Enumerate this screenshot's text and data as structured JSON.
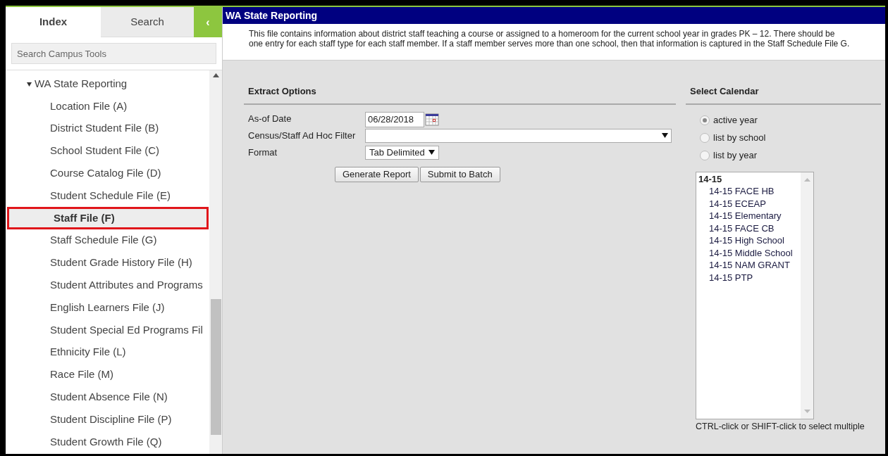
{
  "sidebar": {
    "tabs": [
      {
        "label": "Index",
        "selected": true
      },
      {
        "label": "Search",
        "selected": false
      }
    ],
    "collapse_button": "‹",
    "search": {
      "placeholder": "Search Campus Tools"
    },
    "tree": [
      {
        "label": "WA State Reporting",
        "expanded": true,
        "children": [
          {
            "label": "Location File (A)",
            "selected": false
          },
          {
            "label": "District Student File (B)",
            "selected": false
          },
          {
            "label": "School Student File (C)",
            "selected": false
          },
          {
            "label": "Course Catalog File (D)",
            "selected": false
          },
          {
            "label": "Student Schedule File (E)",
            "selected": false
          },
          {
            "label": "Staff File (F)",
            "selected": true
          },
          {
            "label": "Staff Schedule File (G)",
            "selected": false
          },
          {
            "label": "Student Grade History File (H)",
            "selected": false
          },
          {
            "label": "Student Attributes and Programs",
            "selected": false
          },
          {
            "label": "English Learners File (J)",
            "selected": false
          },
          {
            "label": "Student Special Ed Programs Fil",
            "selected": false
          },
          {
            "label": "Ethnicity File (L)",
            "selected": false
          },
          {
            "label": "Race File (M)",
            "selected": false
          },
          {
            "label": "Student Absence File (N)",
            "selected": false
          },
          {
            "label": "Student Discipline File (P)",
            "selected": false
          },
          {
            "label": "Student Growth File (Q)",
            "selected": false
          }
        ]
      }
    ]
  },
  "main": {
    "title": "WA State Reporting",
    "description": "This file contains information about district staff teaching a course or assigned to a homeroom for the current school year in grades PK – 12. There should be one entry for each staff type for each staff member. If a staff member serves more than one school, then that information is captured in the Staff Schedule File G.",
    "extract_options": {
      "heading": "Extract Options",
      "fields": [
        {
          "kind": "date",
          "label": "As-of Date",
          "value": "06/28/2018"
        },
        {
          "kind": "select_wide",
          "label": "Census/Staff Ad Hoc Filter"
        },
        {
          "kind": "select",
          "label": "Format",
          "value": "Tab Delimited"
        }
      ],
      "buttons": [
        "Generate Report",
        "Submit to Batch"
      ]
    },
    "select_calendar": {
      "heading": "Select Calendar",
      "options": [
        {
          "label": "active year",
          "selected": true
        },
        {
          "label": "list by school",
          "selected": false
        },
        {
          "label": "list by year",
          "selected": false
        }
      ],
      "list": {
        "group": "14-15",
        "items": [
          "14-15 FACE HB",
          "14-15 ECEAP",
          "14-15 Elementary",
          "14-15 FACE CB",
          "14-15 High School",
          "14-15 Middle School",
          "14-15 NAM GRANT",
          "14-15 PTP"
        ]
      },
      "hint": "CTRL-click or SHIFT-click to select multiple"
    }
  }
}
